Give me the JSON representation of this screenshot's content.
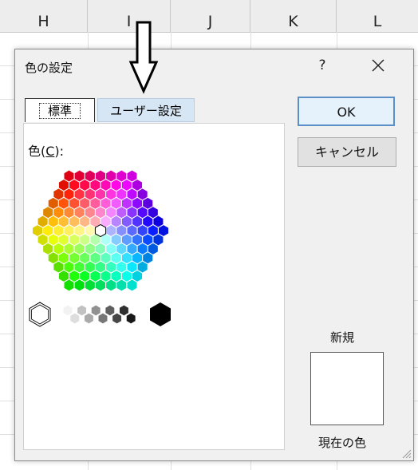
{
  "sheet": {
    "columns": [
      "H",
      "I",
      "J",
      "K",
      "L"
    ]
  },
  "dialog": {
    "title": "色の設定",
    "help_label": "?",
    "close_icon": "close-icon",
    "tabs": [
      {
        "label": "標準",
        "active": true
      },
      {
        "label": "ユーザー設定",
        "active": false
      }
    ],
    "color_label_prefix": "色(",
    "color_label_key": "C",
    "color_label_suffix": "):",
    "ok_label": "OK",
    "cancel_label": "キャンセル",
    "new_label": "新規",
    "current_label": "現在の色",
    "selected_color": "#ffffff",
    "accent": "#5b8fc7"
  },
  "annotation": {
    "icon": "down-arrow-icon"
  }
}
